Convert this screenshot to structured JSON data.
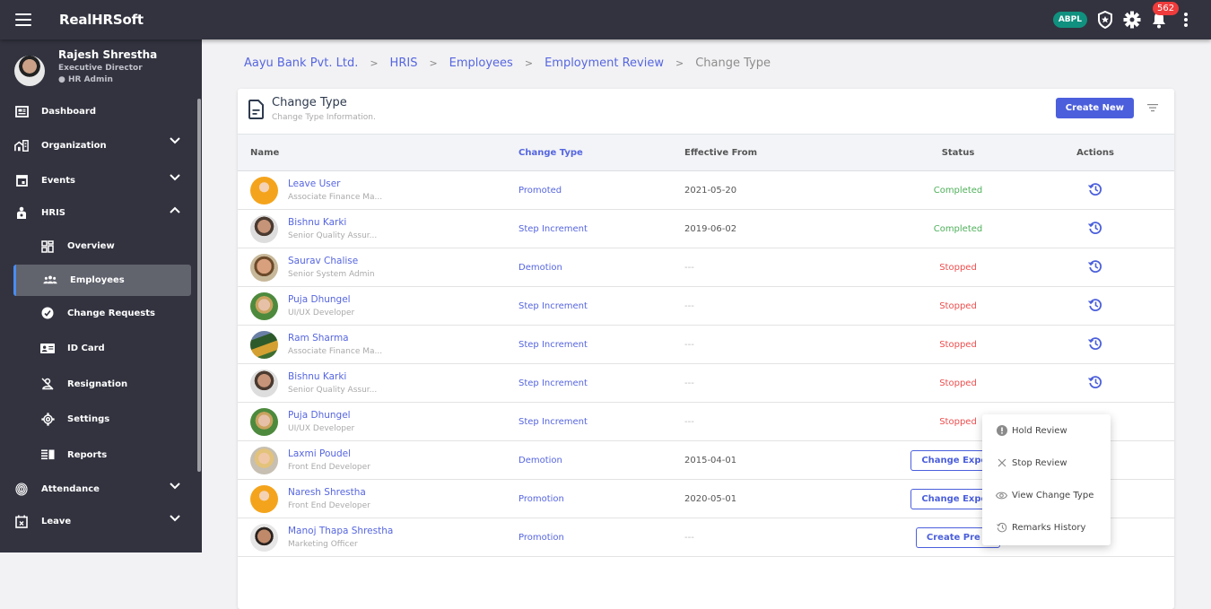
{
  "app": {
    "title": "RealHRSoft"
  },
  "topbar": {
    "org_badge": "ABPL",
    "notification_count": "562"
  },
  "user": {
    "name": "Rajesh Shrestha",
    "role": "Executive Director",
    "access": "HR Admin"
  },
  "sidebar": {
    "items": [
      {
        "label": "Dashboard"
      },
      {
        "label": "Organization"
      },
      {
        "label": "Events"
      },
      {
        "label": "HRIS"
      }
    ],
    "hris_sub": [
      {
        "label": "Overview"
      },
      {
        "label": "Employees"
      },
      {
        "label": "Change Requests"
      },
      {
        "label": "ID Card"
      },
      {
        "label": "Resignation"
      },
      {
        "label": "Settings"
      },
      {
        "label": "Reports"
      }
    ],
    "bottom": [
      {
        "label": "Attendance"
      },
      {
        "label": "Leave"
      }
    ]
  },
  "breadcrumb": [
    "Aayu Bank Pvt. Ltd.",
    "HRIS",
    "Employees",
    "Employment Review",
    "Change Type"
  ],
  "card": {
    "title": "Change Type",
    "subtitle": "Change Type Information.",
    "create_label": "Create New"
  },
  "table": {
    "headers": [
      "Name",
      "Change Type",
      "Effective From",
      "Status",
      "Actions"
    ],
    "rows": [
      {
        "name": "Leave User",
        "designation": "Associate Finance Ma...",
        "type": "Promoted",
        "effective": "2021-05-20",
        "status": "Completed",
        "action": "history"
      },
      {
        "name": "Bishnu Karki",
        "designation": "Senior Quality Assur...",
        "type": "Step Increment",
        "effective": "2019-06-02",
        "status": "Completed",
        "action": "history"
      },
      {
        "name": "Saurav Chalise",
        "designation": "Senior System Admin",
        "type": "Demotion",
        "effective": "---",
        "status": "Stopped",
        "action": "history"
      },
      {
        "name": "Puja Dhungel",
        "designation": "UI/UX Developer",
        "type": "Step Increment",
        "effective": "---",
        "status": "Stopped",
        "action": "history"
      },
      {
        "name": "Ram Sharma",
        "designation": "Associate Finance Ma...",
        "type": "Step Increment",
        "effective": "---",
        "status": "Stopped",
        "action": "history"
      },
      {
        "name": "Bishnu Karki",
        "designation": "Senior Quality Assur...",
        "type": "Step Increment",
        "effective": "---",
        "status": "Stopped",
        "action": "history"
      },
      {
        "name": "Puja Dhungel",
        "designation": "UI/UX Developer",
        "type": "Step Increment",
        "effective": "---",
        "status": "Stopped",
        "action": "history"
      },
      {
        "name": "Laxmi Poudel",
        "designation": "Front End Developer",
        "type": "Demotion",
        "effective": "2015-04-01",
        "status_button": "Change Experi",
        "action": ""
      },
      {
        "name": "Naresh Shrestha",
        "designation": "Front End Developer",
        "type": "Promotion",
        "effective": "2020-05-01",
        "status_button": "Change Experi",
        "action": ""
      },
      {
        "name": "Manoj Thapa Shrestha",
        "designation": "Marketing Officer",
        "type": "Promotion",
        "effective": "---",
        "status_button": "Create Pre T",
        "action": ""
      }
    ]
  },
  "context_menu": {
    "items": [
      {
        "label": "Hold Review",
        "icon": "exclamation-circle-icon"
      },
      {
        "label": "Stop Review",
        "icon": "close-icon"
      },
      {
        "label": "View Change Type",
        "icon": "eye-icon"
      },
      {
        "label": "Remarks History",
        "icon": "history-icon"
      }
    ]
  },
  "colors": {
    "accent": "#4b5fdc",
    "link": "#5666e0",
    "completed": "#4fb05a",
    "stopped": "#ef4e4e",
    "sidebar": "#32333f",
    "badge": "#10917f"
  }
}
